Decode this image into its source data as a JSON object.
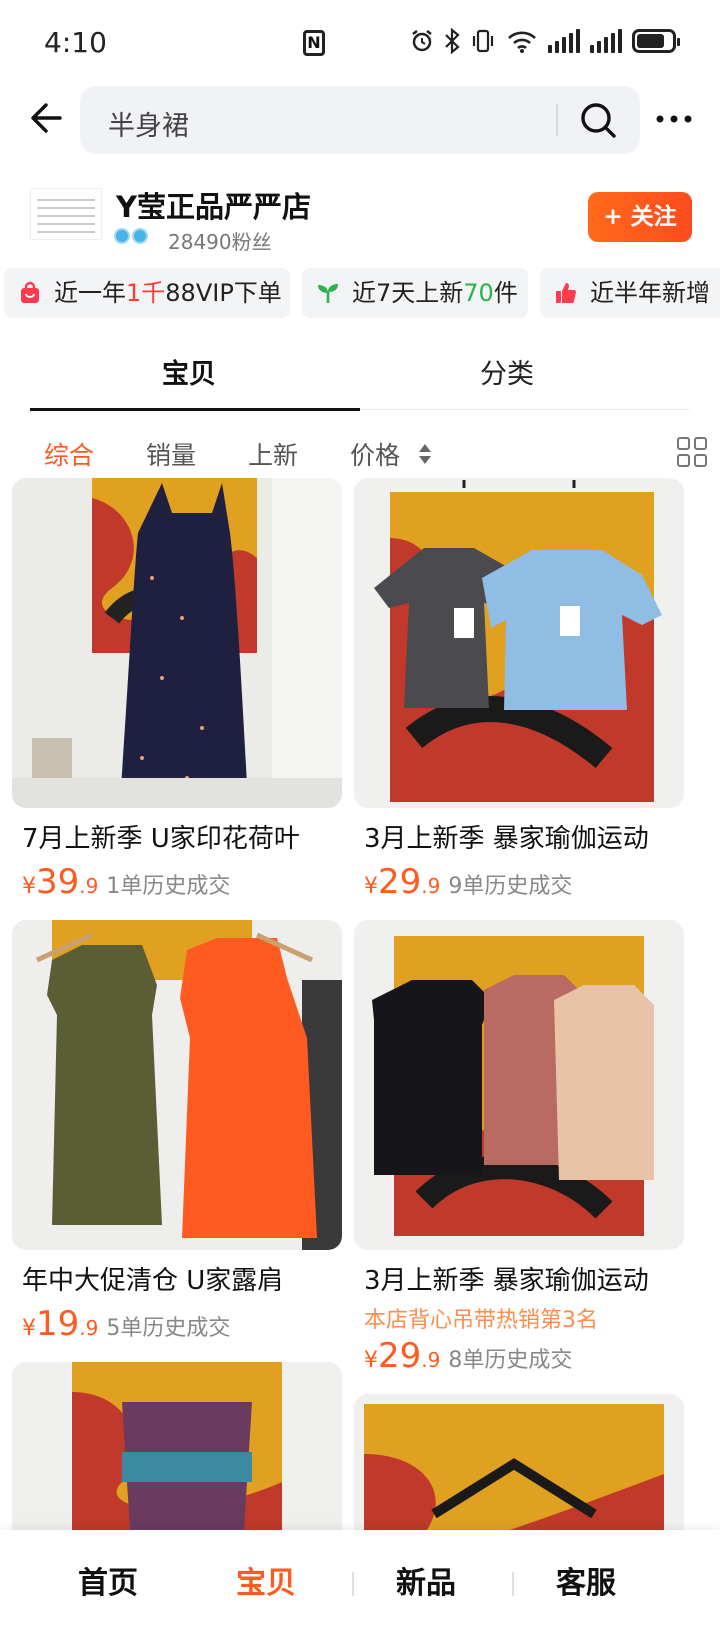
{
  "status_bar": {
    "time": "4:10",
    "icons": [
      "nfc-icon",
      "alarm-icon",
      "bluetooth-icon",
      "vibrate-icon",
      "wifi-icon",
      "signal-icon",
      "signal-icon",
      "battery-icon"
    ]
  },
  "search": {
    "query": "半身裙"
  },
  "shop": {
    "name": "Y莹正品严严店",
    "fans": "28490粉丝",
    "follow_label": "+ 关注",
    "accent": "#ff5a1f"
  },
  "chips": [
    {
      "pre": "近一年",
      "hl": "1千",
      "post": "88VIP下单",
      "hl_color": "red"
    },
    {
      "pre": "近7天上新",
      "hl": "70",
      "post": "件",
      "hl_color": "green"
    },
    {
      "pre": "近半年新增",
      "hl": "",
      "post": "",
      "hl_color": "red"
    }
  ],
  "tabs": [
    {
      "label": "宝贝"
    },
    {
      "label": "分类"
    }
  ],
  "filters": {
    "items": [
      "综合",
      "销量",
      "上新",
      "价格"
    ]
  },
  "products": [
    {
      "title": "7月上新季 U家印花荷叶",
      "currency": "¥",
      "price_int": "39",
      "price_dec": ".9",
      "sold": "1单历史成交"
    },
    {
      "title": "3月上新季 暴家瑜伽运动",
      "currency": "¥",
      "price_int": "29",
      "price_dec": ".9",
      "sold": "9单历史成交"
    },
    {
      "title": "年中大促清仓 U家露肩",
      "currency": "¥",
      "price_int": "19",
      "price_dec": ".9",
      "sold": "5单历史成交"
    },
    {
      "title": "3月上新季 暴家瑜伽运动",
      "currency": "¥",
      "price_int": "29",
      "price_dec": ".9",
      "sold": "8单历史成交",
      "rank": "本店背心吊带热销第3名"
    }
  ],
  "bottom_nav": {
    "items": [
      "首页",
      "宝贝",
      "新品",
      "客服"
    ]
  }
}
